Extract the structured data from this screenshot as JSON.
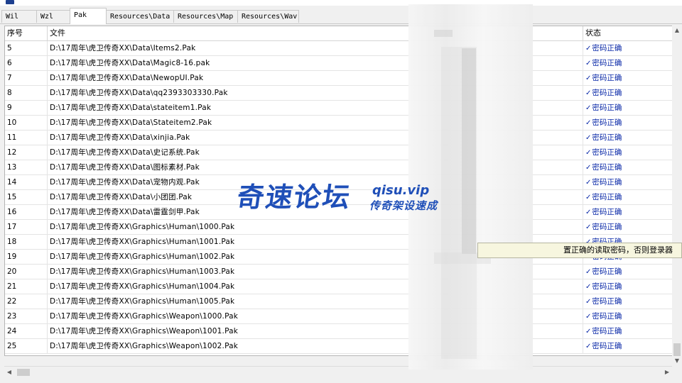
{
  "tabs": [
    {
      "label": "Wil"
    },
    {
      "label": "Wzl"
    },
    {
      "label": "Pak",
      "active": true
    },
    {
      "label": "Resources\\Data"
    },
    {
      "label": "Resources\\Map"
    },
    {
      "label": "Resources\\Wav"
    }
  ],
  "table": {
    "headers": {
      "index": "序号",
      "file": "文件",
      "status": "状态"
    },
    "rows": [
      {
        "index": "5",
        "file": "D:\\17周年\\虎卫传奇XX\\Data\\Items2.Pak",
        "status": "密码正确"
      },
      {
        "index": "6",
        "file": "D:\\17周年\\虎卫传奇XX\\Data\\Magic8-16.pak",
        "status": "密码正确"
      },
      {
        "index": "7",
        "file": "D:\\17周年\\虎卫传奇XX\\Data\\NewopUI.Pak",
        "status": "密码正确"
      },
      {
        "index": "8",
        "file": "D:\\17周年\\虎卫传奇XX\\Data\\qq2393303330.Pak",
        "status": "密码正确"
      },
      {
        "index": "9",
        "file": "D:\\17周年\\虎卫传奇XX\\Data\\stateitem1.Pak",
        "status": "密码正确"
      },
      {
        "index": "10",
        "file": "D:\\17周年\\虎卫传奇XX\\Data\\Stateitem2.Pak",
        "status": "密码正确"
      },
      {
        "index": "11",
        "file": "D:\\17周年\\虎卫传奇XX\\Data\\xinjia.Pak",
        "status": "密码正确"
      },
      {
        "index": "12",
        "file": "D:\\17周年\\虎卫传奇XX\\Data\\史记系统.Pak",
        "status": "密码正确"
      },
      {
        "index": "13",
        "file": "D:\\17周年\\虎卫传奇XX\\Data\\图标素材.Pak",
        "status": "密码正确"
      },
      {
        "index": "14",
        "file": "D:\\17周年\\虎卫传奇XX\\Data\\宠物内观.Pak",
        "status": "密码正确"
      },
      {
        "index": "15",
        "file": "D:\\17周年\\虎卫传奇XX\\Data\\小团团.Pak",
        "status": "密码正确"
      },
      {
        "index": "16",
        "file": "D:\\17周年\\虎卫传奇XX\\Data\\雷霆剑甲.Pak",
        "status": "密码正确"
      },
      {
        "index": "17",
        "file": "D:\\17周年\\虎卫传奇XX\\Graphics\\Human\\1000.Pak",
        "status": "密码正确"
      },
      {
        "index": "18",
        "file": "D:\\17周年\\虎卫传奇XX\\Graphics\\Human\\1001.Pak",
        "status": "密码正确"
      },
      {
        "index": "19",
        "file": "D:\\17周年\\虎卫传奇XX\\Graphics\\Human\\1002.Pak",
        "status": "密码正确"
      },
      {
        "index": "20",
        "file": "D:\\17周年\\虎卫传奇XX\\Graphics\\Human\\1003.Pak",
        "status": "密码正确"
      },
      {
        "index": "21",
        "file": "D:\\17周年\\虎卫传奇XX\\Graphics\\Human\\1004.Pak",
        "status": "密码正确"
      },
      {
        "index": "22",
        "file": "D:\\17周年\\虎卫传奇XX\\Graphics\\Human\\1005.Pak",
        "status": "密码正确"
      },
      {
        "index": "23",
        "file": "D:\\17周年\\虎卫传奇XX\\Graphics\\Weapon\\1000.Pak",
        "status": "密码正确"
      },
      {
        "index": "24",
        "file": "D:\\17周年\\虎卫传奇XX\\Graphics\\Weapon\\1001.Pak",
        "status": "密码正确"
      },
      {
        "index": "25",
        "file": "D:\\17周年\\虎卫传奇XX\\Graphics\\Weapon\\1002.Pak",
        "status": "密码正确"
      }
    ]
  },
  "tooltip": {
    "text": "置正确的读取密码，否则登录器"
  },
  "watermark": {
    "name": "奇速论坛",
    "url": "qisu.vip",
    "subtitle": "传奇架设速成"
  },
  "icons": {
    "status_check": "check-icon"
  },
  "colors": {
    "status_text": "#0b2aa8",
    "watermark": "#1f4fb8",
    "tooltip_bg": "#f7f6df"
  }
}
